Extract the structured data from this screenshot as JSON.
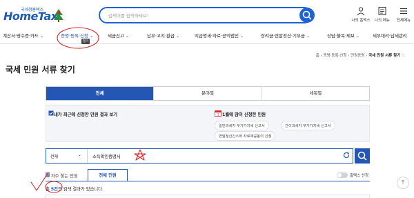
{
  "header": {
    "logo_sub": "국세청홈택스",
    "logo_main": "HomeTax",
    "search_placeholder": "검색어를 입력하세요!",
    "utils": [
      {
        "label": "나의 홈택스",
        "icon": "person-icon"
      },
      {
        "label": "나의 메뉴",
        "icon": "my-menu-icon"
      },
      {
        "label": "전체메뉴",
        "icon": "hamburger-icon"
      }
    ]
  },
  "nav": {
    "items": [
      "계산서·영수증·카드",
      "증명·등록·신청",
      "세금신고",
      "납부·고지·환급",
      "지급명세·자료·공익법인",
      "장려금·연말정산·기부금",
      "상담·불복·제보",
      "세무대리·납세관리"
    ],
    "active_index": 1,
    "tooltip": "열기"
  },
  "breadcrumb": {
    "home": "홈",
    "path": [
      "증명·등록·신청",
      "민원증명"
    ],
    "current": "국세 민원 서류 찾기"
  },
  "page": {
    "title": "국세 민원 서류 찾기"
  },
  "tabs": [
    {
      "label": "전체",
      "active": true
    },
    {
      "label": "분야별",
      "active": false
    },
    {
      "label": "세목별",
      "active": false
    }
  ],
  "info": {
    "left_title": "내가 최근에 신청한 민원 결과 보기",
    "right_title": "1월에 많이 신청한 민원",
    "calendar_day": "1",
    "chips": [
      "일반과세자 부가가치세 신고서",
      "간이과세자 부가가치세 신고서",
      "연말정산간소화 자료제공동의 신청"
    ]
  },
  "search": {
    "select_value": "전체",
    "query": "소득확인증명서"
  },
  "subtabs": {
    "frequent": "자주 찾는 민원",
    "all": "전체 민원",
    "toggle_label": "홈택스 신청"
  },
  "result": {
    "prefix": "총 ",
    "count": "5건",
    "suffix": "의 검색 결과가 있습니다."
  },
  "colors": {
    "primary": "#2456b4",
    "annotation": "#d9262a"
  }
}
